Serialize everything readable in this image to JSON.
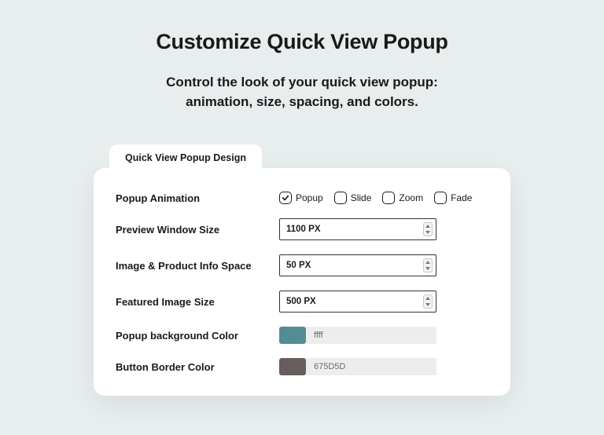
{
  "header": {
    "title": "Customize Quick View Popup",
    "subtitle_line1": "Control the look of your quick view popup:",
    "subtitle_line2": "animation, size, spacing, and colors."
  },
  "tab": {
    "label": "Quick View Popup Design"
  },
  "fields": {
    "animation": {
      "label": "Popup Animation",
      "options": {
        "popup": "Popup",
        "slide": "Slide",
        "zoom": "Zoom",
        "fade": "Fade"
      },
      "selected": "popup"
    },
    "preview_size": {
      "label": "Preview Window Size",
      "value": "1100 PX"
    },
    "info_space": {
      "label": "Image & Product Info Space",
      "value": "50 PX"
    },
    "featured_size": {
      "label": "Featured Image Size",
      "value": "500 PX"
    },
    "popup_bg": {
      "label": "Popup background Color",
      "value": "ffff",
      "swatch": "#548C96"
    },
    "btn_border": {
      "label": "Button Border Color",
      "value": "675D5D",
      "swatch": "#675D5D"
    }
  }
}
